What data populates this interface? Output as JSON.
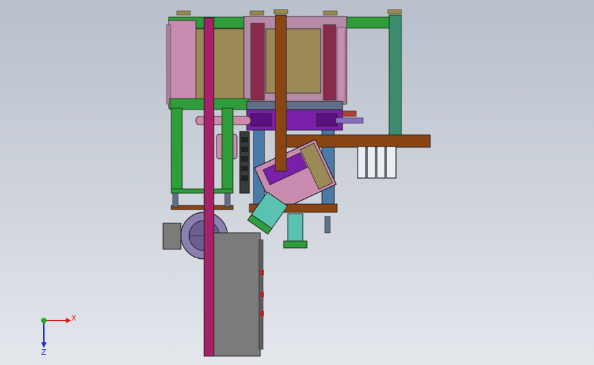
{
  "viewport": {
    "background_top": "#b9bfcb",
    "background_bottom": "#e4e7ec"
  },
  "model": {
    "part_colors": {
      "frame_green": "#2f9e3a",
      "teal": "#3c8d6e",
      "brown": "#8a4513",
      "magenta": "#a8206a",
      "purple": "#7a1fa8",
      "pink": "#c98bb0",
      "olive": "#9b8a55",
      "gray": "#7b7b7b",
      "steel": "#5f6f8a",
      "cyan": "#59c2b0"
    }
  },
  "triad": {
    "x_label": "X",
    "z_label": "Z",
    "x_color": "#d61a1a",
    "y_color": "#1faa1f",
    "z_color": "#1a2fd6"
  }
}
